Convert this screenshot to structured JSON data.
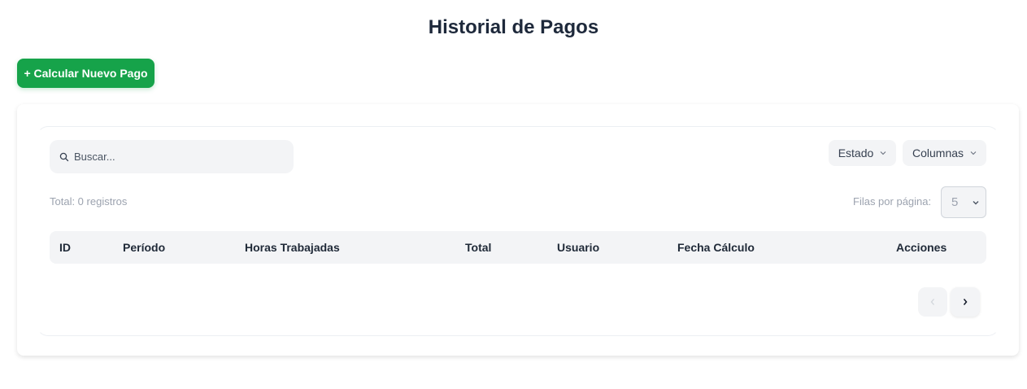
{
  "page": {
    "title": "Historial de Pagos"
  },
  "toolbar": {
    "add_label": "+ Calcular Nuevo Pago"
  },
  "search": {
    "placeholder": "Buscar..."
  },
  "filters": {
    "estado_label": "Estado",
    "columnas_label": "Columnas"
  },
  "summary": {
    "total_text": "Total: 0 registros"
  },
  "pagination": {
    "rows_label": "Filas por página:",
    "rows_value": "5"
  },
  "table": {
    "columns": [
      "ID",
      "Período",
      "Horas Trabajadas",
      "Total",
      "Usuario",
      "Fecha Cálculo",
      "Acciones"
    ]
  },
  "colors": {
    "accent": "#16a34a",
    "muted": "#f3f4f6"
  }
}
